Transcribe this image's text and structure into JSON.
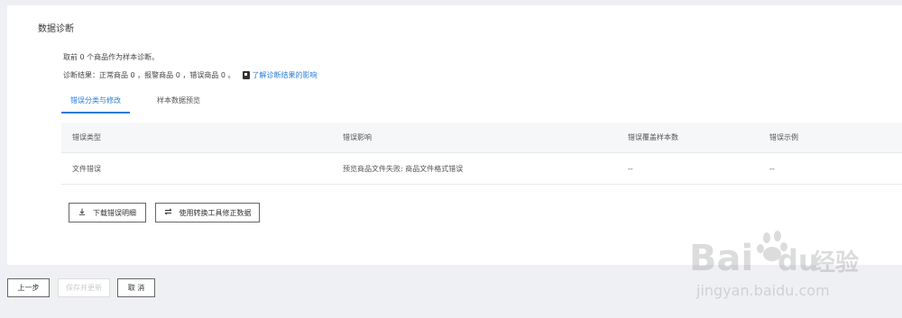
{
  "section": {
    "title": "数据诊断"
  },
  "summary": {
    "sample_line": "取前 0 个商品作为样本诊断。",
    "result_line": "诊断结果：正常商品 0 ，报警商品 0 ，错误商品 0 。",
    "impact_link": "了解诊断结果的影响",
    "impact_icon": "doc-icon"
  },
  "tabs": [
    {
      "label": "错误分类与修改",
      "active": true
    },
    {
      "label": "样本数据预览",
      "active": false
    }
  ],
  "table": {
    "headers": [
      "错误类型",
      "错误影响",
      "错误覆盖样本数",
      "错误示例"
    ],
    "rows": [
      [
        "文件错误",
        "预览商品文件失败: 商品文件格式错误",
        "--",
        "--"
      ]
    ]
  },
  "actions": {
    "download_label": "下载错误明细",
    "download_icon": "download-icon",
    "convert_label": "使用转换工具修正数据",
    "convert_icon": "swap-icon"
  },
  "footer": {
    "prev_label": "上一步",
    "save_label": "保存并更新",
    "cancel_label": "取 消"
  },
  "watermark": {
    "brand": "Bai",
    "brand2": "du",
    "cn": "经验",
    "url": "jingyan.baidu.com"
  },
  "colors": {
    "accent": "#2a7cd8",
    "background": "#eef0f3"
  }
}
